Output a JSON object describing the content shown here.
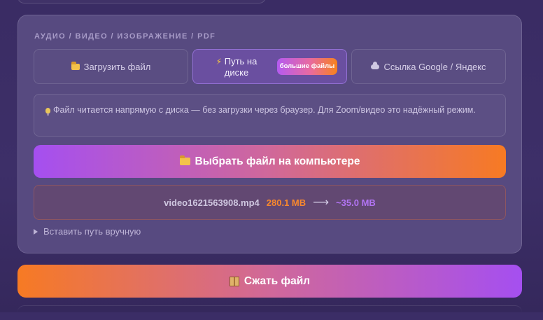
{
  "section_label": "Аудио / Видео / Изображение / PDF",
  "tabs": {
    "upload": {
      "icon": "folder-icon",
      "label": "Загрузить файл"
    },
    "path": {
      "icon": "lightning-icon",
      "label": "Путь на диске",
      "badge": "большие файлы"
    },
    "link": {
      "icon": "cloud-icon",
      "label": "Ссылка Google / Яндекс"
    }
  },
  "info": {
    "icon": "lightbulb-icon",
    "text": "Файл читается напрямую с диска — без загрузки через браузер. Для Zoom/видео это надёжный режим."
  },
  "choose_button": {
    "icon": "folder-icon",
    "label": "Выбрать файл на компьютере"
  },
  "file": {
    "name": "video1621563908.mp4",
    "size": "280.1 MB",
    "arrow": "⟶",
    "estimated": "~35.0 MB"
  },
  "manual_path_toggle": "Вставить путь вручную",
  "compress_button": {
    "icon": "package-icon",
    "label": "Сжать файл"
  },
  "colors": {
    "accent_purple": "#a54ff0",
    "accent_orange": "#f77a23",
    "card_bg": "#574a80",
    "page_bg": "#3b2d66"
  }
}
